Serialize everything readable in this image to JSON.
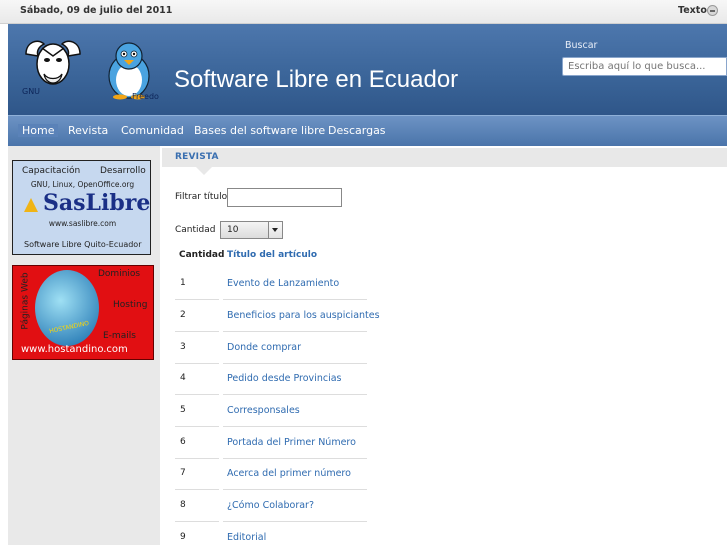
{
  "topbar": {
    "date": "Sábado, 09 de julio del 2011",
    "text_size_label": "Texto"
  },
  "header": {
    "site_title": "Software Libre en Ecuador",
    "gnu_label": "GNU",
    "freedo_label": "Freedo",
    "search_label": "Buscar",
    "search_placeholder": "Escriba aquí lo que busca..."
  },
  "nav": {
    "items": [
      "Home",
      "Revista",
      "Comunidad",
      "Bases del software libre",
      "Descargas"
    ]
  },
  "sidebar": {
    "banner1": {
      "capacitacion": "Capacitación",
      "desarrollo": "Desarrollo",
      "subtitle": "GNU, Linux, OpenOffice.org",
      "logo": "SasLibre",
      "website": "www.saslibre.com",
      "footer": "Software Libre  Quito-Ecuador"
    },
    "banner2": {
      "side": "Páginas Web",
      "dominios": "Dominios",
      "hosting": "Hosting",
      "emails": "E-mails",
      "brand": "HOSTANDINO",
      "website": "www.hostandino.com"
    }
  },
  "content": {
    "section_title": "REVISTA",
    "filter_label": "Filtrar título",
    "count_label": "Cantidad",
    "count_value": "10",
    "col_count": "Cantidad",
    "col_title": "Título del artículo",
    "articles": [
      {
        "n": "1",
        "title": "Evento de Lanzamiento"
      },
      {
        "n": "2",
        "title": "Beneficios para los auspiciantes"
      },
      {
        "n": "3",
        "title": "Donde comprar"
      },
      {
        "n": "4",
        "title": "Pedido desde Provincias"
      },
      {
        "n": "5",
        "title": "Corresponsales"
      },
      {
        "n": "6",
        "title": "Portada del Primer Número"
      },
      {
        "n": "7",
        "title": "Acerca del primer número"
      },
      {
        "n": "8",
        "title": "¿Cómo Colaborar?"
      },
      {
        "n": "9",
        "title": "Editorial"
      }
    ]
  }
}
